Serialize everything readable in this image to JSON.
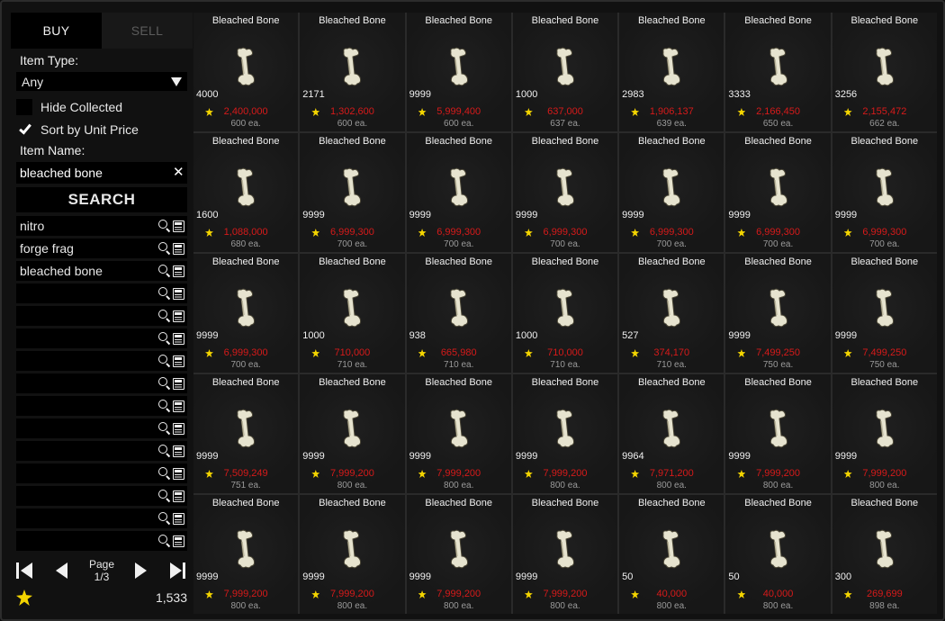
{
  "tabs": {
    "buy": "BUY",
    "sell": "SELL"
  },
  "filters": {
    "item_type_label": "Item Type:",
    "item_type_value": "Any",
    "hide_collected_label": "Hide Collected",
    "hide_collected_checked": false,
    "sort_unit_label": "Sort by Unit Price",
    "sort_unit_checked": true,
    "item_name_label": "Item Name:",
    "item_name_value": "bleached bone",
    "search_label": "SEARCH"
  },
  "saved_searches": [
    "nitro",
    "forge frag",
    "bleached bone",
    "",
    "",
    "",
    "",
    "",
    "",
    "",
    "",
    "",
    "",
    "",
    ""
  ],
  "pager": {
    "label": "Page",
    "current": "1/3"
  },
  "balance": "1,533",
  "colors": {
    "price": "#d61a1a",
    "coin": "#f3d400",
    "unit": "#9a9a9a"
  },
  "item_name": "Bleached Bone",
  "listings": [
    {
      "qty": "4000",
      "price": "2,400,000",
      "unit": "600 ea."
    },
    {
      "qty": "2171",
      "price": "1,302,600",
      "unit": "600 ea."
    },
    {
      "qty": "9999",
      "price": "5,999,400",
      "unit": "600 ea."
    },
    {
      "qty": "1000",
      "price": "637,000",
      "unit": "637 ea."
    },
    {
      "qty": "2983",
      "price": "1,906,137",
      "unit": "639 ea."
    },
    {
      "qty": "3333",
      "price": "2,166,450",
      "unit": "650 ea."
    },
    {
      "qty": "3256",
      "price": "2,155,472",
      "unit": "662 ea."
    },
    {
      "qty": "1600",
      "price": "1,088,000",
      "unit": "680 ea."
    },
    {
      "qty": "9999",
      "price": "6,999,300",
      "unit": "700 ea."
    },
    {
      "qty": "9999",
      "price": "6,999,300",
      "unit": "700 ea."
    },
    {
      "qty": "9999",
      "price": "6,999,300",
      "unit": "700 ea."
    },
    {
      "qty": "9999",
      "price": "6,999,300",
      "unit": "700 ea."
    },
    {
      "qty": "9999",
      "price": "6,999,300",
      "unit": "700 ea."
    },
    {
      "qty": "9999",
      "price": "6,999,300",
      "unit": "700 ea."
    },
    {
      "qty": "9999",
      "price": "6,999,300",
      "unit": "700 ea."
    },
    {
      "qty": "1000",
      "price": "710,000",
      "unit": "710 ea."
    },
    {
      "qty": "938",
      "price": "665,980",
      "unit": "710 ea."
    },
    {
      "qty": "1000",
      "price": "710,000",
      "unit": "710 ea."
    },
    {
      "qty": "527",
      "price": "374,170",
      "unit": "710 ea."
    },
    {
      "qty": "9999",
      "price": "7,499,250",
      "unit": "750 ea."
    },
    {
      "qty": "9999",
      "price": "7,499,250",
      "unit": "750 ea."
    },
    {
      "qty": "9999",
      "price": "7,509,249",
      "unit": "751 ea."
    },
    {
      "qty": "9999",
      "price": "7,999,200",
      "unit": "800 ea."
    },
    {
      "qty": "9999",
      "price": "7,999,200",
      "unit": "800 ea."
    },
    {
      "qty": "9999",
      "price": "7,999,200",
      "unit": "800 ea."
    },
    {
      "qty": "9964",
      "price": "7,971,200",
      "unit": "800 ea."
    },
    {
      "qty": "9999",
      "price": "7,999,200",
      "unit": "800 ea."
    },
    {
      "qty": "9999",
      "price": "7,999,200",
      "unit": "800 ea."
    },
    {
      "qty": "9999",
      "price": "7,999,200",
      "unit": "800 ea."
    },
    {
      "qty": "9999",
      "price": "7,999,200",
      "unit": "800 ea."
    },
    {
      "qty": "9999",
      "price": "7,999,200",
      "unit": "800 ea."
    },
    {
      "qty": "9999",
      "price": "7,999,200",
      "unit": "800 ea."
    },
    {
      "qty": "50",
      "price": "40,000",
      "unit": "800 ea."
    },
    {
      "qty": "50",
      "price": "40,000",
      "unit": "800 ea."
    },
    {
      "qty": "300",
      "price": "269,699",
      "unit": "898 ea."
    }
  ]
}
